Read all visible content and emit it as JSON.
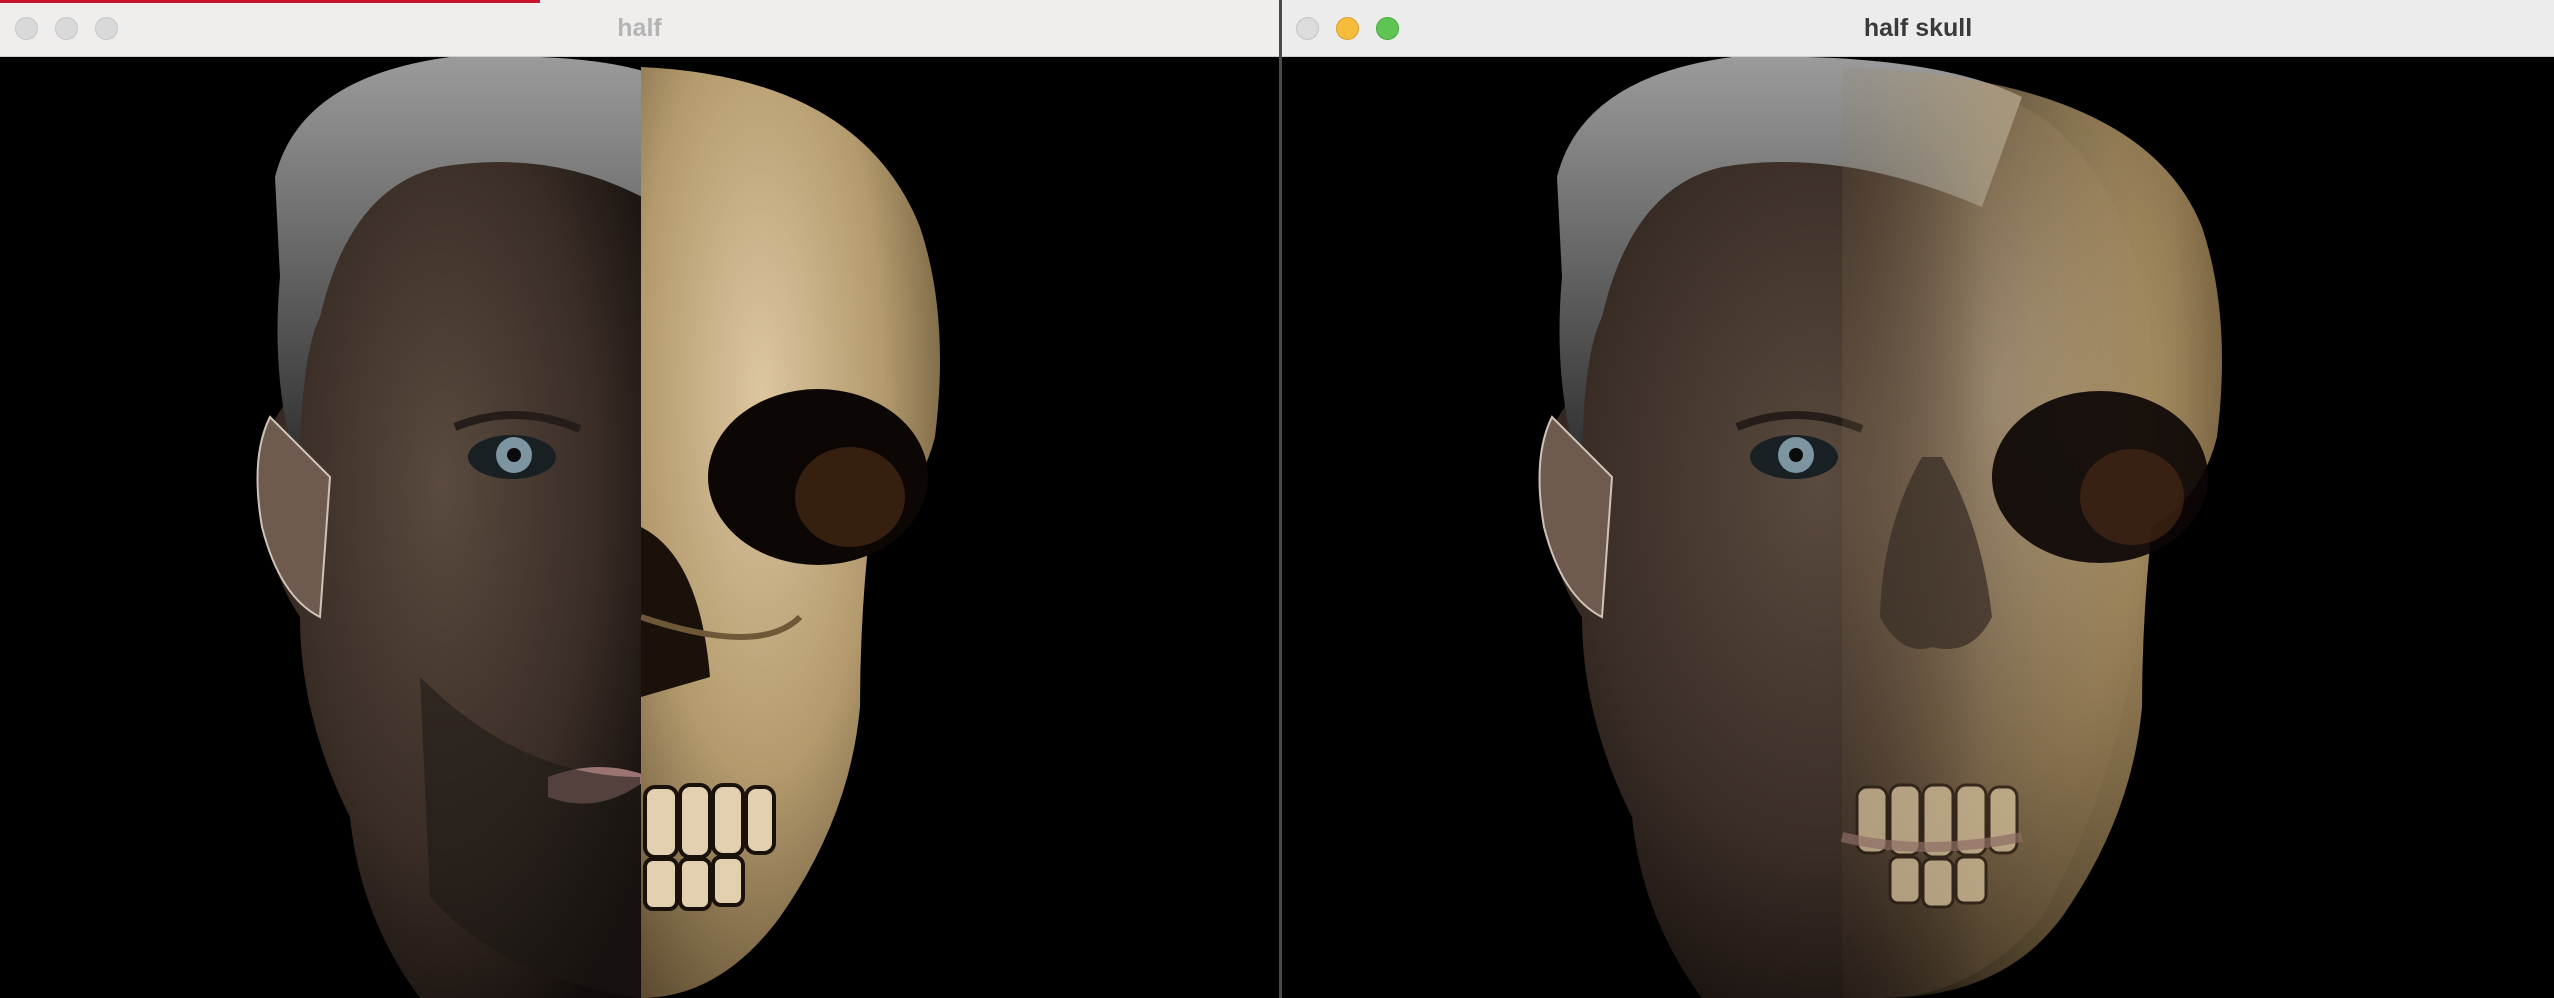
{
  "windows": [
    {
      "title": "half",
      "state": "inactive",
      "image": "face-left-half-skull-right-half"
    },
    {
      "title": "half skull",
      "state": "active",
      "image": "face-with-blended-skull-overlay"
    }
  ],
  "colors": {
    "background": "#000000",
    "close_dim": "#dcdcdc",
    "minimize": "#f6bd3b",
    "maximize": "#5fc454"
  }
}
